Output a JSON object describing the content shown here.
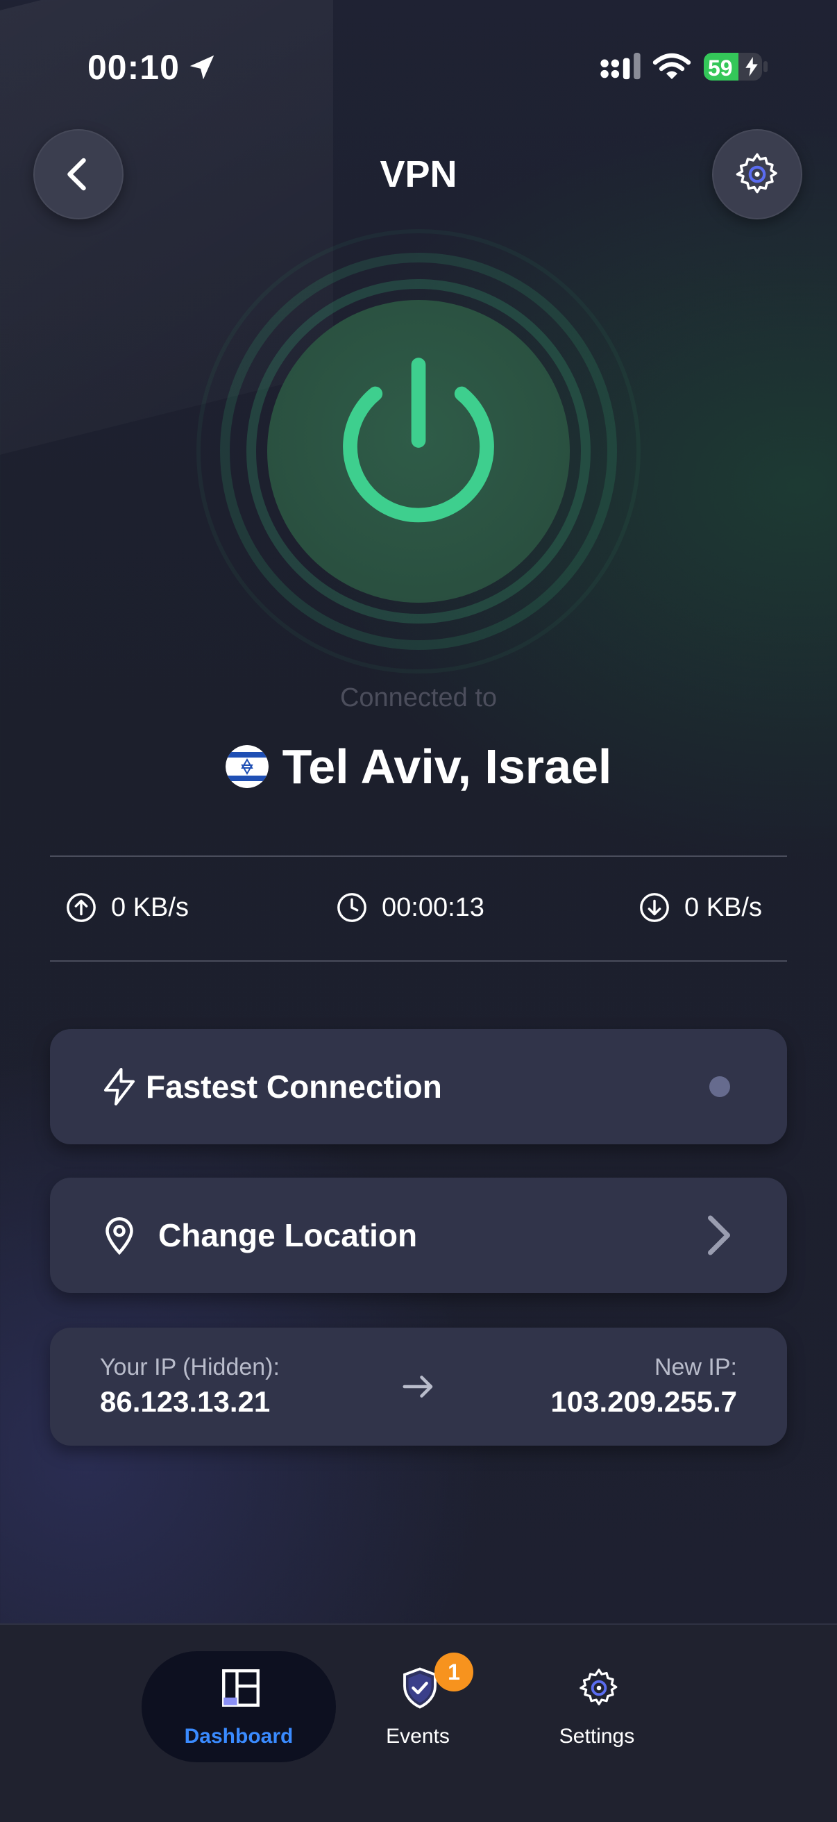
{
  "status_bar": {
    "time": "00:10",
    "battery": "59"
  },
  "header": {
    "title": "VPN"
  },
  "connection": {
    "connected_label": "Connected to",
    "location": "Tel Aviv, Israel"
  },
  "stats": {
    "upload": "0 KB/s",
    "duration": "00:00:13",
    "download": "0 KB/s"
  },
  "cards": {
    "fastest": "Fastest Connection",
    "change_location": "Change Location",
    "ip": {
      "your_ip_label": "Your IP (Hidden):",
      "your_ip": "86.123.13.21",
      "new_ip_label": "New IP:",
      "new_ip": "103.209.255.7"
    }
  },
  "nav": {
    "dashboard": "Dashboard",
    "events": "Events",
    "events_badge": "1",
    "settings": "Settings"
  },
  "colors": {
    "accent_green": "#3ecf8e",
    "nav_active": "#3a8bff",
    "badge": "#f7931e"
  },
  "icons": [
    "location-arrow-icon",
    "signal-icon",
    "wifi-icon",
    "battery-icon",
    "back-chevron-icon",
    "gear-icon",
    "power-icon",
    "israel-flag-icon",
    "upload-icon",
    "clock-icon",
    "download-icon",
    "lightning-icon",
    "location-pin-icon",
    "chevron-right-icon",
    "arrow-right-icon",
    "dashboard-icon",
    "shield-check-icon",
    "settings-gear-icon"
  ]
}
